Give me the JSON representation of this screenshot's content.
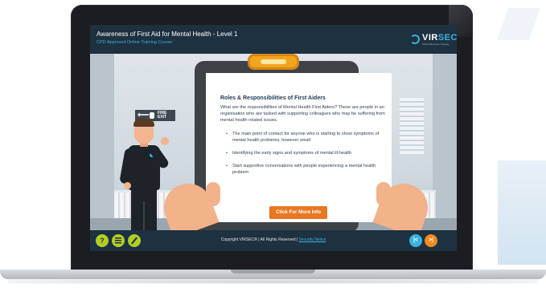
{
  "header": {
    "course_title": "Awareness of First Aid for Mental Health - Level 1",
    "course_subtitle": "CPD Approved Online Training Course",
    "logo_text": "VIR",
    "logo_text_accent": "SEC",
    "logo_tagline": "Online Business Training"
  },
  "scene": {
    "fire_sign_text": "FIRE EXIT",
    "fire_sign_word1": "FIRE",
    "fire_sign_word2": "EXIT",
    "fire_arrow_glyph": "⟵"
  },
  "content": {
    "title": "Roles & Responsibilities of First Aiders",
    "intro": "What are the responsibilities of Mental Health First Aiders? These are people in an organisation who are tasked with supporting colleagues who may be suffering from mental health related issues.",
    "bullets": [
      "The main point of contact for anyone who is starting to show symptoms of mental health problems, however small",
      "Identifying the early signs and symptoms of mental ill-health",
      "Start supportive conversations with people experiencing a mental health problem"
    ],
    "more_info_label": "Click For More Info"
  },
  "footer": {
    "help_label": "?",
    "copyright": "Copyright VIRSEC® | All Rights Reserved | ",
    "security_link": "Security Notice",
    "prev_label": "|<",
    "next_label": ">|"
  },
  "icons": {
    "help": "question-icon",
    "menu": "list-icon",
    "notes": "pencil-icon",
    "prev": "previous-icon",
    "next": "next-icon"
  },
  "colors": {
    "bar_bg": "#1d3140",
    "accent_blue": "#3bb2e0",
    "accent_green": "#b4cd25",
    "accent_orange": "#e87722",
    "title_color": "#1d3a52"
  }
}
